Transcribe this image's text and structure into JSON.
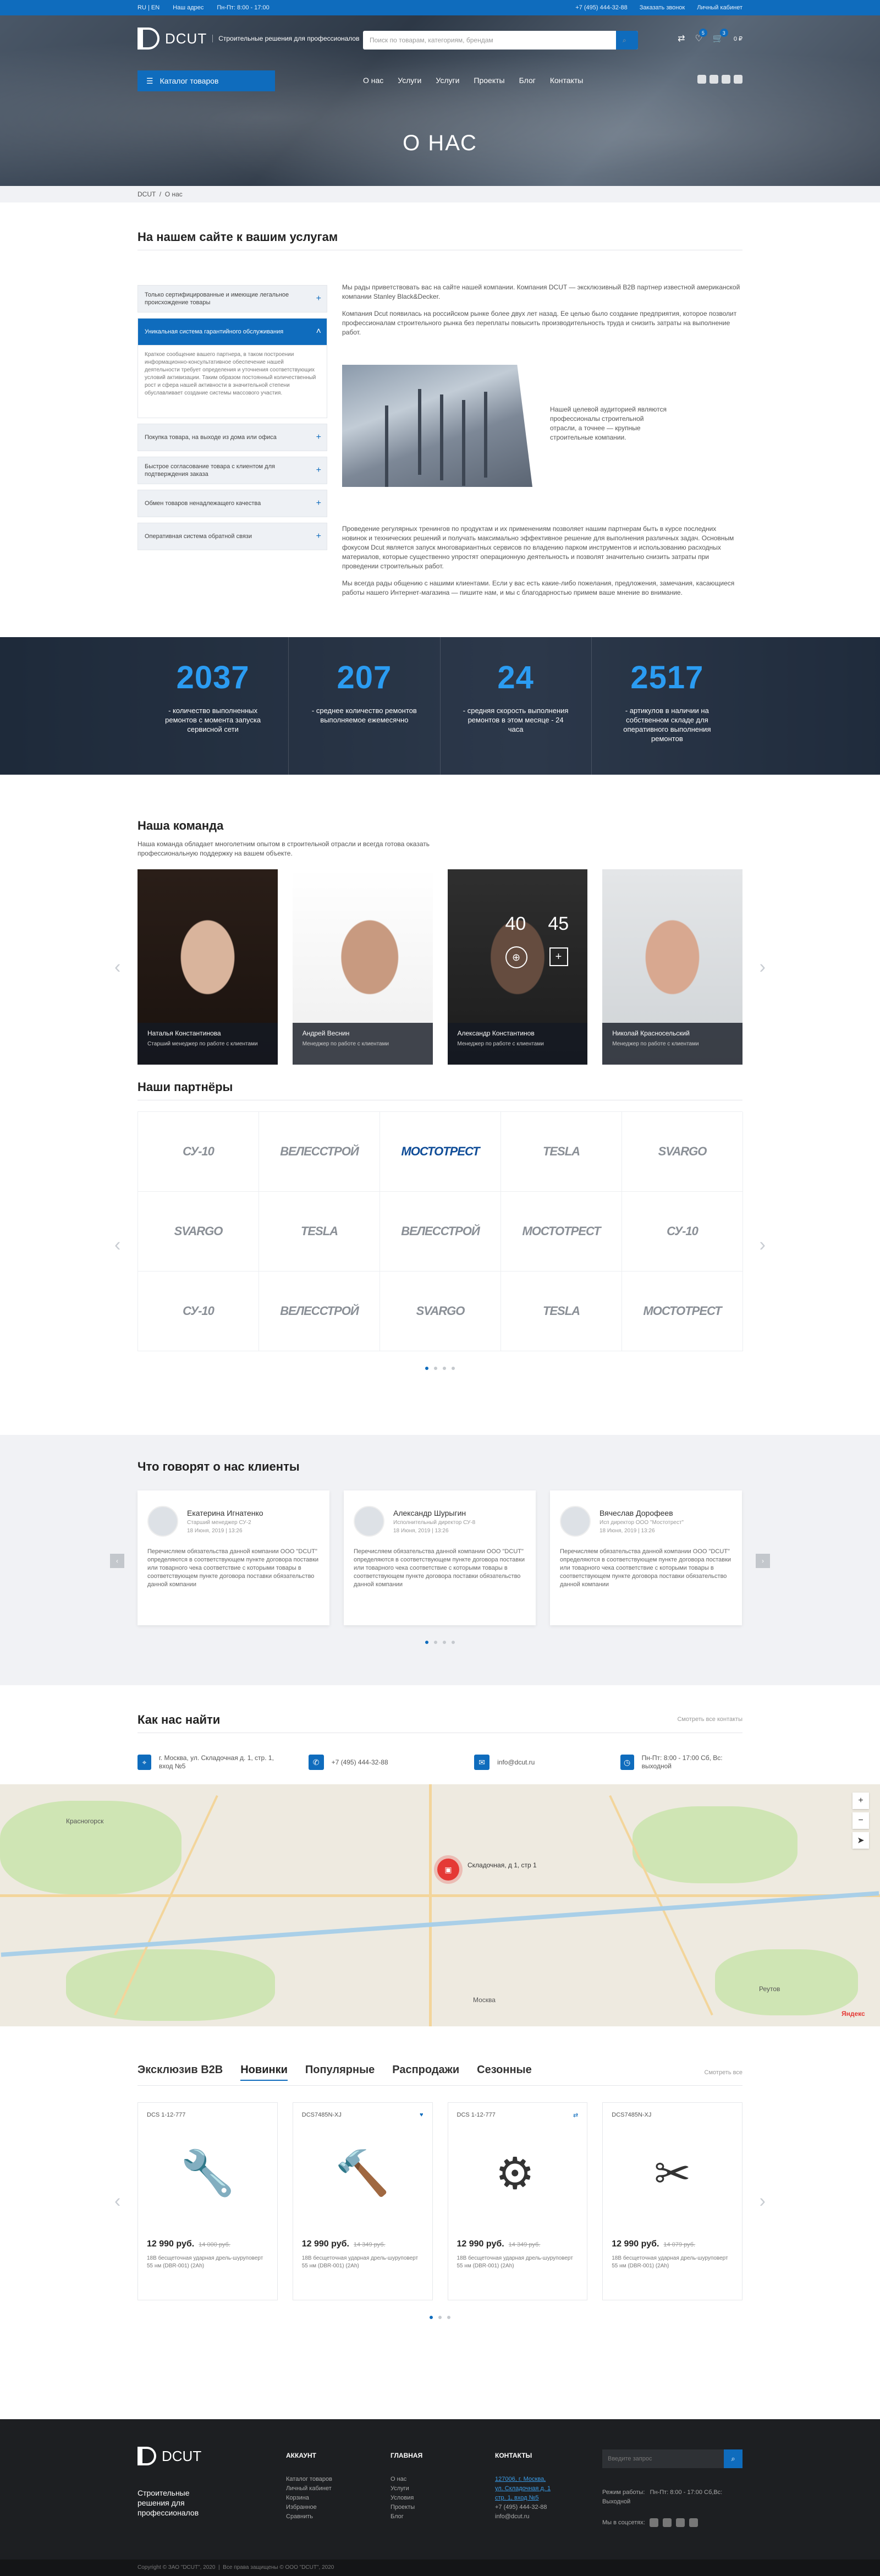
{
  "topbar": {
    "lang": "RU | EN",
    "hours_link": "Наш адрес",
    "worktime": "Пн-Пт: 8:00 - 17:00",
    "phone": "+7 (495) 444-32-88",
    "callback": "Заказать звонок",
    "account": "Личный кабинет"
  },
  "header": {
    "brand": "DCUT",
    "tagline": "Строительные решения для профессионалов",
    "search_placeholder": "Поиск по товарам, категориям, брендам",
    "wishlist_count": "5",
    "cart_count": "3",
    "cart_sum": "0 ₽",
    "catalog": "Каталог товаров",
    "nav": [
      "О нас",
      "Услуги",
      "Услуги",
      "Проекты",
      "Блог",
      "Контакты"
    ],
    "page_title": "О НАС"
  },
  "breadcrumbs": {
    "home": "DCUT",
    "current": "О нас"
  },
  "about": {
    "title": "На нашем сайте к вашим услугам",
    "accordion": [
      {
        "label": "Только сертифицированные и имеющие легальное происхождение товары"
      },
      {
        "label": "Уникальная система гарантийного обслуживания",
        "body": "Краткое сообщение вашего партнера, в таком построении информационно-консультативное обеспечение нашей деятельности требует определения и уточнения соответствующих условий активизации. Таким образом постоянный количественный рост и сфера нашей активности в значительной степени обуславливает создание системы массового участия."
      },
      {
        "label": "Покупка товара, на выходе из дома или офиса"
      },
      {
        "label": "Быстрое согласование товара с клиентом для подтверждения заказа"
      },
      {
        "label": "Обмен товаров ненадлежащего качества"
      },
      {
        "label": "Оперативная система обратной связи"
      }
    ],
    "p1": "Мы рады приветствовать вас на сайте нашей компании. Компания DCUT — эксклюзивный B2B партнер известной американской компании Stanley Black&Decker.",
    "p2": "Компания Dcut появилась на российском рынке более двух лет назад. Ее целью было создание предприятия, которое позволит профессионалам строительного рынка без переплаты повысить производительность труда и снизить затраты на выполнение работ.",
    "quote": "Нашей целевой аудиторией являются профессионалы строительной отрасли, а точнее — крупные строительные компании.",
    "p3": "Проведение регулярных тренингов по продуктам и их применениям позволяет нашим партнерам быть в курсе последних новинок и технических решений и получать максимально эффективное решение для выполнения различных задач. Основным фокусом Dcut является запуск многовариантных сервисов по владению парком инструментов и использованию расходных материалов, которые существенно упростят операционную деятельность и позволят значительно снизить затраты при проведении строительных работ.",
    "p4": "Мы всегда рады общению с нашими клиентами. Если у вас есть какие-либо пожелания, предложения, замечания, касающиеся работы нашего Интернет-магазина — пишите нам, и мы с благодарностью примем ваше мнение во внимание."
  },
  "stats": [
    {
      "num": "2037",
      "label": "- количество выполненных ремонтов с момента запуска сервисной сети"
    },
    {
      "num": "207",
      "label": "- среднее количество ремонтов выполняемое ежемесячно"
    },
    {
      "num": "24",
      "label": "- средняя скорость выполнения ремонтов в этом месяце - 24 часа"
    },
    {
      "num": "2517",
      "label": "- артикулов в наличии на собственном складе для оперативного выполнения ремонтов"
    }
  ],
  "team": {
    "title": "Наша команда",
    "lead": "Наша команда обладает многолетним опытом в строительной отрасли и всегда готова оказать профессиональную поддержку на вашем объекте.",
    "members": [
      {
        "name": "Наталья Константинова",
        "role": "Старший менеджер по работе с клиентами",
        "color": "#3a2a22"
      },
      {
        "name": "Андрей Веснин",
        "role": "Менеджер по работе с клиентами",
        "color": "#8a6a55"
      },
      {
        "name": "Александр Константинов",
        "role": "Менеджер по работе с клиентами",
        "color": "#4a4a4a",
        "n1": "40",
        "n2": "45"
      },
      {
        "name": "Николай Красносельский",
        "role": "Менеджер по работе с клиентами",
        "color": "#6a5040"
      }
    ]
  },
  "partners": {
    "title": "Наши партнёры",
    "logos": [
      "СУ-10",
      "ВЕЛЕССТРОЙ",
      "МОСТОТРЕСТ",
      "TESLA",
      "SVARGO",
      "SVARGO",
      "TESLA",
      "ВЕЛЕССТРОЙ",
      "МОСТОТРЕСТ",
      "СУ-10",
      "СУ-10",
      "ВЕЛЕССТРОЙ",
      "SVARGO",
      "TESLA",
      "МОСТОТРЕСТ"
    ]
  },
  "reviews": {
    "title": "Что говорят о нас клиенты",
    "items": [
      {
        "name": "Екатерина Игнатенко",
        "role": "Старший менеджер СУ-2",
        "date": "18 Июня, 2019 | 13:26",
        "text": "Перечисляем обязательства данной компании ООО \"DCUT\" определяются в соответствующем пункте договора поставки или товарного чека соответствие с которыми товары в соответствующем пункте договора поставки обязательство данной компании"
      },
      {
        "name": "Александр Шурыгин",
        "role": "Исполнительный директор СУ-8",
        "date": "18 Июня, 2019 | 13:26",
        "text": "Перечисляем обязательства данной компании ООО \"DCUT\" определяются в соответствующем пункте договора поставки или товарного чека соответствие с которыми товары в соответствующем пункте договора поставки обязательство данной компании"
      },
      {
        "name": "Вячеслав Дорофеев",
        "role": "Исп директор ООО \"Мостотрест\"",
        "date": "18 Июня, 2019 | 13:26",
        "text": "Перечисляем обязательства данной компании ООО \"DCUT\" определяются в соответствующем пункте договора поставки или товарного чека соответствие с которыми товары в соответствующем пункте договора поставки обязательство данной компании"
      }
    ]
  },
  "contacts": {
    "title": "Как нас найти",
    "all": "Смотреть все контакты",
    "address": "г. Москва, ул. Складочная д. 1, стр. 1, вход №5",
    "phone": "+7 (495) 444-32-88",
    "email": "info@dcut.ru",
    "hours": "Пн-Пт: 8:00 - 17:00 Сб, Вс: выходной"
  },
  "map": {
    "pin_label": "Складочная, д 1, стр 1",
    "cities": [
      "Красногорск",
      "Москва",
      "Реутов",
      "Яндекс"
    ]
  },
  "products": {
    "tabs": [
      "Эксклюзив B2B",
      "Новинки",
      "Популярные",
      "Распродажи",
      "Сезонные"
    ],
    "all": "Смотреть все",
    "items": [
      {
        "code": "DCS 1-12-777",
        "price": "12 990 руб.",
        "old": "14 000 руб.",
        "desc": "18В бесщеточная ударная дрель-шуруповерт 55 нм (DBR-001) (2Ah)",
        "icon": "🔧"
      },
      {
        "code": "DCS7485N-XJ",
        "price": "12 990 руб.",
        "old": "14 349 руб.",
        "desc": "18В бесщеточная ударная дрель-шуруповерт 55 нм (DBR-001) (2Ah)",
        "icon": "🔨"
      },
      {
        "code": "DCS 1-12-777",
        "price": "12 990 руб.",
        "old": "14 349 руб.",
        "desc": "18В бесщеточная ударная дрель-шуруповерт 55 нм (DBR-001) (2Ah)",
        "icon": "⚙"
      },
      {
        "code": "DCS7485N-XJ",
        "price": "12 990 руб.",
        "old": "14 079 руб.",
        "desc": "18В бесщеточная ударная дрель-шуруповерт 55 нм (DBR-001) (2Ah)",
        "icon": "✂"
      }
    ]
  },
  "footer": {
    "brand": "DCUT",
    "tagline": "Строительные решения для профессионалов",
    "cols": [
      {
        "title": "АККАУНТ",
        "items": [
          "Каталог товаров",
          "Личный кабинет",
          "Корзина",
          "Избранное",
          "Сравнить"
        ]
      },
      {
        "title": "ГЛАВНАЯ",
        "items": [
          "О нас",
          "Услуги",
          "Условия",
          "Проекты",
          "Блог"
        ]
      },
      {
        "title": "КОНТАКТЫ",
        "items": [
          "127006, г. Москва,",
          "ул. Складочная д. 1",
          "стр. 1, вход №5",
          "+7 (495) 444-32-88",
          "info@dcut.ru"
        ]
      }
    ],
    "search_placeholder": "Введите запрос",
    "hours_label": "Режим работы:",
    "hours": "Пн-Пт: 8:00 - 17:00 Сб,Вс: Выходной",
    "social_label": "Мы в соцсетях:",
    "copyright": "Copyright © ЗАО \"DCUT\", 2020",
    "rights": "Все права защищены © ООО \"DCUT\", 2020"
  }
}
